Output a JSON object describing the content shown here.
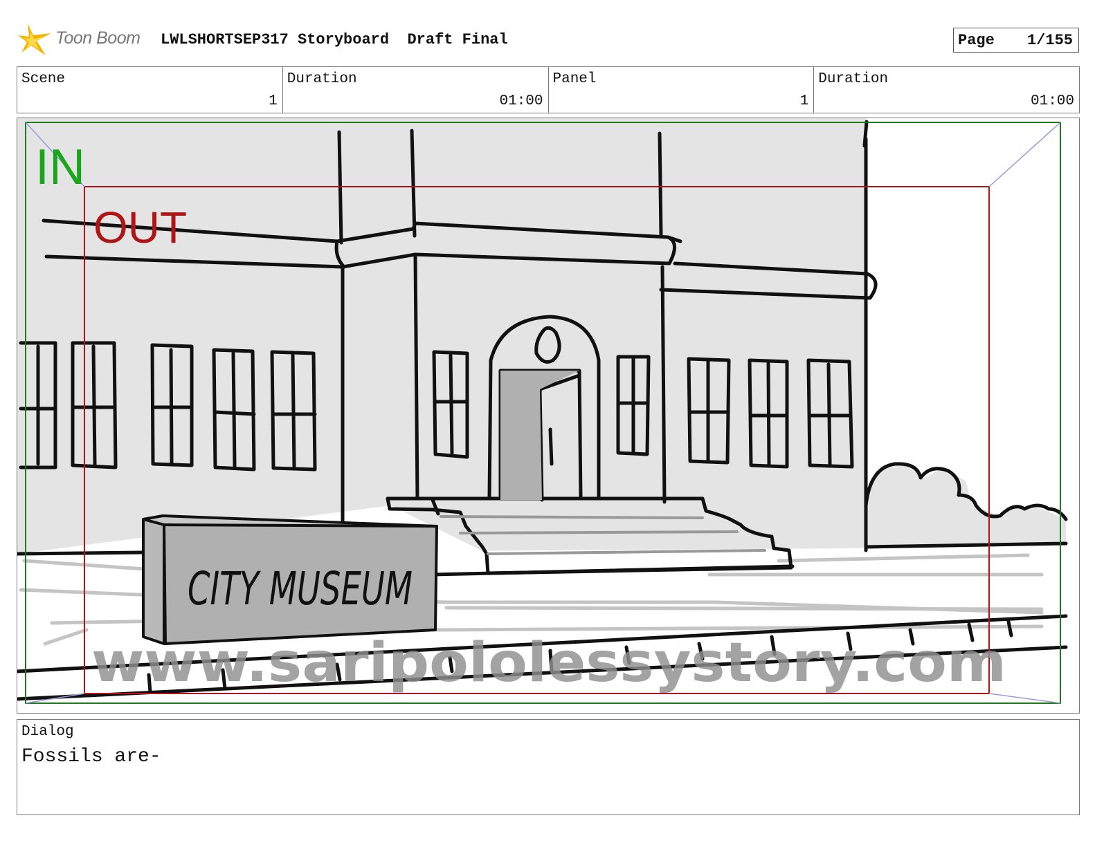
{
  "header": {
    "brand": "Toon Boom",
    "title": "LWLSHORTSEP317 Storyboard",
    "status": "Draft Final",
    "page_label": "Page",
    "page_value": "1/155"
  },
  "info": {
    "scene_label": "Scene",
    "scene_value": "1",
    "scene_duration_label": "Duration",
    "scene_duration_value": "01:00",
    "panel_label": "Panel",
    "panel_value": "1",
    "panel_duration_label": "Duration",
    "panel_duration_value": "01:00"
  },
  "panel": {
    "in_label": "IN",
    "out_label": "OUT",
    "in_color": "#1aa61a",
    "out_color": "#b01515",
    "sign_text": "CITY MUSEUM",
    "watermark": "www.saripololessystory.com"
  },
  "dialog": {
    "label": "Dialog",
    "text": "Fossils are-"
  }
}
